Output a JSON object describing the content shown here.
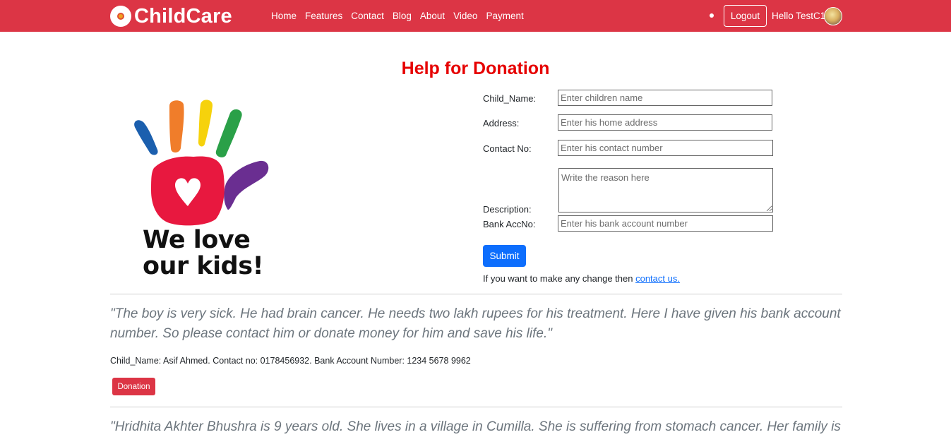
{
  "nav": {
    "brand": "ChildCare",
    "links": [
      "Home",
      "Features",
      "Contact",
      "Blog",
      "About",
      "Video",
      "Payment"
    ],
    "logout_label": "Logout",
    "greeting": "Hello TestC1"
  },
  "page": {
    "title": "Help for Donation"
  },
  "hero_image": {
    "caption_line1": "We love",
    "caption_line2": "our kids!",
    "colors": [
      "#1b5fae",
      "#f07d2a",
      "#f6d20c",
      "#2aa048",
      "#6a2e91",
      "#e8183f"
    ]
  },
  "form": {
    "child_name_label": "Child_Name:",
    "child_name_placeholder": "Enter children name",
    "address_label": "Address:",
    "address_placeholder": "Enter his home address",
    "contact_label": "Contact No:",
    "contact_placeholder": "Enter his contact number",
    "description_label": "Description:",
    "description_placeholder": "Write the reason here",
    "bank_label": "Bank AccNo:",
    "bank_placeholder": "Enter his bank account number",
    "submit_label": "Submit",
    "change_note": "If you want to make any change then ",
    "contact_link": "contact us."
  },
  "posts": [
    {
      "quote": "\"The boy is very sick. He had brain cancer. He needs two lakh rupees for his treatment. Here I have given his bank account number. So please contact him or donate money for him and save his life.\"",
      "info": "Child_Name: Asif Ahmed. Contact no: 0178456932. Bank Account Number: 1234 5678 9962",
      "button_label": "Donation"
    },
    {
      "quote": "\"Hridhita Akhter Bhushra is 9 years old. She lives in a village in Cumilla. She is suffering from stomach cancer. Her family is"
    }
  ],
  "colors": {
    "navbar": "#dc3545",
    "title": "#e60000",
    "submit": "#0d6efd",
    "donation": "#dc3545"
  }
}
